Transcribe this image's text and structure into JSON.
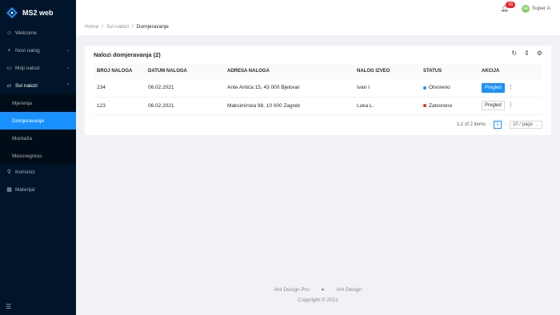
{
  "app": {
    "title": "MS2 web"
  },
  "sidebar": {
    "items": [
      {
        "label": "Welcome",
        "icon": "smile-icon"
      },
      {
        "label": "Novi nalog",
        "icon": "plus-icon"
      },
      {
        "label": "Moji nalozi",
        "icon": "folder-icon"
      },
      {
        "label": "Svi nalozi",
        "icon": "folder-open-icon"
      },
      {
        "label": "Korisnici",
        "icon": "user-icon"
      },
      {
        "label": "Materijal",
        "icon": "table-icon"
      }
    ],
    "subitems": [
      "Mjerenja",
      "Domjeravanje",
      "Montaža",
      "Messregress"
    ]
  },
  "header": {
    "notification_count": "99",
    "avatar_initials": "SA",
    "user_name": "Super A"
  },
  "breadcrumb": [
    "Home",
    "Svi nalozi",
    "Domjeravanje"
  ],
  "card": {
    "title": "Nalozi domjeravanja (2)"
  },
  "table": {
    "columns": [
      "BROJ NALOGA",
      "DATUM NALOGA",
      "ADRESA NALOGA",
      "NALOG IZVEO",
      "STATUS",
      "AKCIJA"
    ],
    "rows": [
      {
        "broj": "234",
        "datum": "06.02.2021",
        "adresa": "Ante Antića 15, 43 000 Bjelovar",
        "izveo": "Ivan I",
        "status": "Otvoreno",
        "status_color": "#1890ff",
        "akcija": "Pregled",
        "primary": true
      },
      {
        "broj": "123",
        "datum": "06.02.2021",
        "adresa": "Maksimirska 98, 10 000 Zagreb",
        "izveo": "Luka L.",
        "status": "Zatvoreno",
        "status_color": "#f5222d",
        "akcija": "Pregled",
        "primary": false
      }
    ]
  },
  "pagination": {
    "summary": "1-2 of 2 items",
    "current": "1",
    "page_size": "10 / page"
  },
  "footer": {
    "link1": "Ant Design Pro",
    "link2": "Ant Design",
    "copyright": "Copyright © 2021"
  }
}
